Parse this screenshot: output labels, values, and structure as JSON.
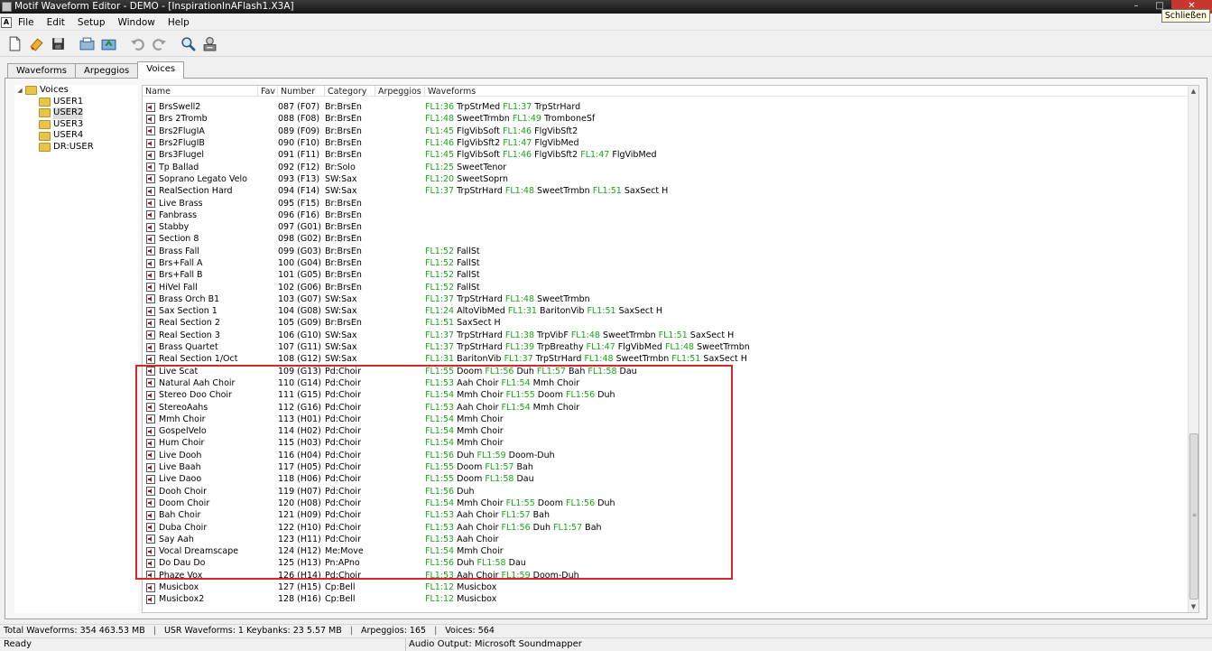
{
  "window": {
    "title": "Motif Waveform Editor - DEMO - [InspirationInAFlash1.X3A]",
    "close_tooltip": "Schließen"
  },
  "menu": [
    "File",
    "Edit",
    "Setup",
    "Window",
    "Help"
  ],
  "toolbar": [
    "new-file-icon",
    "open-file-icon",
    "save-icon",
    "import-icon",
    "export-icon",
    "undo-icon",
    "redo-icon",
    "search-icon",
    "audio-settings-icon"
  ],
  "tabs": [
    "Waveforms",
    "Arpeggios",
    "Voices"
  ],
  "active_tab": "Voices",
  "tree": {
    "root": "Voices",
    "children": [
      "USER1",
      "USER2",
      "USER3",
      "USER4",
      "DR:USER"
    ],
    "selected": "USER2"
  },
  "columns": [
    "Name",
    "Fav",
    "Number",
    "Category",
    "Arpeggios",
    "Waveforms"
  ],
  "rows": [
    {
      "name": "BrsSwell2",
      "num": "087 (F07)",
      "cat": "Br:BrsEn",
      "wav": [
        [
          "FL1:36",
          "TrpStrMed"
        ],
        [
          "FL1:37",
          "TrpStrHard"
        ]
      ]
    },
    {
      "name": "Brs 2Tromb",
      "num": "088 (F08)",
      "cat": "Br:BrsEn",
      "wav": [
        [
          "FL1:48",
          "SweetTrmbn"
        ],
        [
          "FL1:49",
          "TromboneSf"
        ]
      ]
    },
    {
      "name": "Brs2FlugIA",
      "num": "089 (F09)",
      "cat": "Br:BrsEn",
      "wav": [
        [
          "FL1:45",
          "FlgVibSoft"
        ],
        [
          "FL1:46",
          "FlgVibSft2"
        ]
      ]
    },
    {
      "name": "Brs2FlugIB",
      "num": "090 (F10)",
      "cat": "Br:BrsEn",
      "wav": [
        [
          "FL1:46",
          "FlgVibSft2"
        ],
        [
          "FL1:47",
          "FlgVibMed"
        ]
      ]
    },
    {
      "name": "Brs3Flugel",
      "num": "091 (F11)",
      "cat": "Br:BrsEn",
      "wav": [
        [
          "FL1:45",
          "FlgVibSoft"
        ],
        [
          "FL1:46",
          "FlgVibSft2"
        ],
        [
          "FL1:47",
          "FlgVibMed"
        ]
      ]
    },
    {
      "name": "Tp Ballad",
      "num": "092 (F12)",
      "cat": "Br:Solo",
      "wav": [
        [
          "FL1:25",
          "SweetTenor"
        ]
      ]
    },
    {
      "name": "Soprano Legato Velo",
      "num": "093 (F13)",
      "cat": "SW:Sax",
      "wav": [
        [
          "FL1:20",
          "SweetSoprn"
        ]
      ]
    },
    {
      "name": "RealSection Hard",
      "num": "094 (F14)",
      "cat": "SW:Sax",
      "wav": [
        [
          "FL1:37",
          "TrpStrHard"
        ],
        [
          "FL1:48",
          "SweetTrmbn"
        ],
        [
          "FL1:51",
          "SaxSect H"
        ]
      ]
    },
    {
      "name": "Live Brass",
      "num": "095 (F15)",
      "cat": "Br:BrsEn",
      "wav": []
    },
    {
      "name": "Fanbrass",
      "num": "096 (F16)",
      "cat": "Br:BrsEn",
      "wav": []
    },
    {
      "name": "Stabby",
      "num": "097 (G01)",
      "cat": "Br:BrsEn",
      "wav": []
    },
    {
      "name": "Section 8",
      "num": "098 (G02)",
      "cat": "Br:BrsEn",
      "wav": []
    },
    {
      "name": "Brass Fall",
      "num": "099 (G03)",
      "cat": "Br:BrsEn",
      "wav": [
        [
          "FL1:52",
          "FallSt"
        ]
      ]
    },
    {
      "name": "Brs+Fall A",
      "num": "100 (G04)",
      "cat": "Br:BrsEn",
      "wav": [
        [
          "FL1:52",
          "FallSt"
        ]
      ]
    },
    {
      "name": "Brs+Fall B",
      "num": "101 (G05)",
      "cat": "Br:BrsEn",
      "wav": [
        [
          "FL1:52",
          "FallSt"
        ]
      ]
    },
    {
      "name": "HiVel Fall",
      "num": "102 (G06)",
      "cat": "Br:BrsEn",
      "wav": [
        [
          "FL1:52",
          "FallSt"
        ]
      ]
    },
    {
      "name": "Brass Orch B1",
      "num": "103 (G07)",
      "cat": "SW:Sax",
      "wav": [
        [
          "FL1:37",
          "TrpStrHard"
        ],
        [
          "FL1:48",
          "SweetTrmbn"
        ]
      ]
    },
    {
      "name": "Sax Section 1",
      "num": "104 (G08)",
      "cat": "SW:Sax",
      "wav": [
        [
          "FL1:24",
          "AltoVibMed"
        ],
        [
          "FL1:31",
          "BaritonVib"
        ],
        [
          "FL1:51",
          "SaxSect H"
        ]
      ]
    },
    {
      "name": "Real Section 2",
      "num": "105 (G09)",
      "cat": "Br:BrsEn",
      "wav": [
        [
          "FL1:51",
          "SaxSect H"
        ]
      ]
    },
    {
      "name": "Real Section 3",
      "num": "106 (G10)",
      "cat": "SW:Sax",
      "wav": [
        [
          "FL1:37",
          "TrpStrHard"
        ],
        [
          "FL1:38",
          "TrpVibF"
        ],
        [
          "FL1:48",
          "SweetTrmbn"
        ],
        [
          "FL1:51",
          "SaxSect H"
        ]
      ]
    },
    {
      "name": "Brass Quartet",
      "num": "107 (G11)",
      "cat": "SW:Sax",
      "wav": [
        [
          "FL1:37",
          "TrpStrHard"
        ],
        [
          "FL1:39",
          "TrpBreathy"
        ],
        [
          "FL1:47",
          "FlgVibMed"
        ],
        [
          "FL1:48",
          "SweetTrmbn"
        ]
      ]
    },
    {
      "name": "Real Section 1/Oct",
      "num": "108 (G12)",
      "cat": "SW:Sax",
      "wav": [
        [
          "FL1:31",
          "BaritonVib"
        ],
        [
          "FL1:37",
          "TrpStrHard"
        ],
        [
          "FL1:48",
          "SweetTrmbn"
        ],
        [
          "FL1:51",
          "SaxSect H"
        ]
      ]
    },
    {
      "name": "Live Scat",
      "num": "109 (G13)",
      "cat": "Pd:Choir",
      "wav": [
        [
          "FL1:55",
          "Doom"
        ],
        [
          "FL1:56",
          "Duh"
        ],
        [
          "FL1:57",
          "Bah"
        ],
        [
          "FL1:58",
          "Dau"
        ]
      ]
    },
    {
      "name": "Natural Aah Choir",
      "num": "110 (G14)",
      "cat": "Pd:Choir",
      "wav": [
        [
          "FL1:53",
          "Aah Choir"
        ],
        [
          "FL1:54",
          "Mmh Choir"
        ]
      ]
    },
    {
      "name": "Stereo Doo Choir",
      "num": "111 (G15)",
      "cat": "Pd:Choir",
      "wav": [
        [
          "FL1:54",
          "Mmh Choir"
        ],
        [
          "FL1:55",
          "Doom"
        ],
        [
          "FL1:56",
          "Duh"
        ]
      ]
    },
    {
      "name": "StereoAahs",
      "num": "112 (G16)",
      "cat": "Pd:Choir",
      "wav": [
        [
          "FL1:53",
          "Aah Choir"
        ],
        [
          "FL1:54",
          "Mmh Choir"
        ]
      ]
    },
    {
      "name": "Mmh Choir",
      "num": "113 (H01)",
      "cat": "Pd:Choir",
      "wav": [
        [
          "FL1:54",
          "Mmh Choir"
        ]
      ]
    },
    {
      "name": "GospelVelo",
      "num": "114 (H02)",
      "cat": "Pd:Choir",
      "wav": [
        [
          "FL1:54",
          "Mmh Choir"
        ]
      ]
    },
    {
      "name": "Hum Choir",
      "num": "115 (H03)",
      "cat": "Pd:Choir",
      "wav": [
        [
          "FL1:54",
          "Mmh Choir"
        ]
      ]
    },
    {
      "name": "Live Dooh",
      "num": "116 (H04)",
      "cat": "Pd:Choir",
      "wav": [
        [
          "FL1:56",
          "Duh"
        ],
        [
          "FL1:59",
          "Doom-Duh"
        ]
      ]
    },
    {
      "name": "Live Baah",
      "num": "117 (H05)",
      "cat": "Pd:Choir",
      "wav": [
        [
          "FL1:55",
          "Doom"
        ],
        [
          "FL1:57",
          "Bah"
        ]
      ]
    },
    {
      "name": "Live Daoo",
      "num": "118 (H06)",
      "cat": "Pd:Choir",
      "wav": [
        [
          "FL1:55",
          "Doom"
        ],
        [
          "FL1:58",
          "Dau"
        ]
      ]
    },
    {
      "name": "Dooh Choir",
      "num": "119 (H07)",
      "cat": "Pd:Choir",
      "wav": [
        [
          "FL1:56",
          "Duh"
        ]
      ]
    },
    {
      "name": "Doom Choir",
      "num": "120 (H08)",
      "cat": "Pd:Choir",
      "wav": [
        [
          "FL1:54",
          "Mmh Choir"
        ],
        [
          "FL1:55",
          "Doom"
        ],
        [
          "FL1:56",
          "Duh"
        ]
      ]
    },
    {
      "name": "Bah Choir",
      "num": "121 (H09)",
      "cat": "Pd:Choir",
      "wav": [
        [
          "FL1:53",
          "Aah Choir"
        ],
        [
          "FL1:57",
          "Bah"
        ]
      ]
    },
    {
      "name": "Duba Choir",
      "num": "122 (H10)",
      "cat": "Pd:Choir",
      "wav": [
        [
          "FL1:53",
          "Aah Choir"
        ],
        [
          "FL1:56",
          "Duh"
        ],
        [
          "FL1:57",
          "Bah"
        ]
      ]
    },
    {
      "name": "Say Aah",
      "num": "123 (H11)",
      "cat": "Pd:Choir",
      "wav": [
        [
          "FL1:53",
          "Aah Choir"
        ]
      ]
    },
    {
      "name": "Vocal  Dreamscape",
      "num": "124 (H12)",
      "cat": "Me:Move",
      "wav": [
        [
          "FL1:54",
          "Mmh Choir"
        ]
      ]
    },
    {
      "name": "Do Dau Do",
      "num": "125 (H13)",
      "cat": "Pn:APno",
      "wav": [
        [
          "FL1:56",
          "Duh"
        ],
        [
          "FL1:58",
          "Dau"
        ]
      ]
    },
    {
      "name": "Phaze Vox",
      "num": "126 (H14)",
      "cat": "Pd:Choir",
      "wav": [
        [
          "FL1:53",
          "Aah Choir"
        ],
        [
          "FL1:59",
          "Doom-Duh"
        ]
      ]
    },
    {
      "name": "Musicbox",
      "num": "127 (H15)",
      "cat": "Cp:Bell",
      "wav": [
        [
          "FL1:12",
          "Musicbox"
        ]
      ]
    },
    {
      "name": "Musicbox2",
      "num": "128 (H16)",
      "cat": "Cp:Bell",
      "wav": [
        [
          "FL1:12",
          "Musicbox"
        ]
      ]
    }
  ],
  "status": {
    "total_waveforms": "Total Waveforms: 354   463.53 MB",
    "usr_waveforms": "USR  Waveforms: 1    Keybanks: 23    5.57 MB",
    "arpeggios": "Arpeggios: 165",
    "voices": "Voices: 564",
    "ready": "Ready",
    "audio_output": "Audio Output: Microsoft Soundmapper"
  },
  "colors": {
    "waveform_id": "#1aa31a",
    "highlight_box": "#d9262c"
  }
}
